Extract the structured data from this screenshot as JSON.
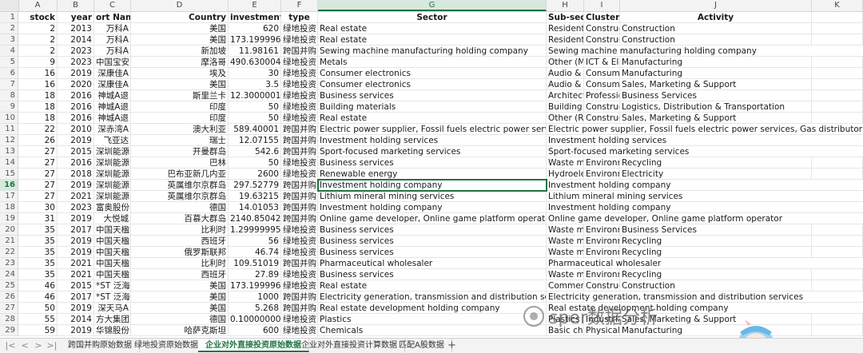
{
  "columns": [
    "A",
    "B",
    "C",
    "D",
    "E",
    "F",
    "G",
    "H",
    "I",
    "J",
    "K"
  ],
  "selected_column": "G",
  "selected_row": 16,
  "header": {
    "stock": "stock",
    "year": "year",
    "name": "ort Name",
    "country": "Country",
    "investment": "investment",
    "type": "type",
    "sector": "Sector",
    "subsector": "Sub-secto",
    "cluster": "Cluster",
    "activity": "Activity"
  },
  "rows": [
    {
      "n": 2,
      "a": "2",
      "b": "2013",
      "c": "万科A",
      "d": "美国",
      "e": "620",
      "f": "绿地投资",
      "g": "Real estate",
      "h": "Residentia",
      "i": "Construct",
      "j": "Construction"
    },
    {
      "n": 3,
      "a": "2",
      "b": "2014",
      "c": "万科A",
      "d": "美国",
      "e": "173.1999969",
      "f": "绿地投资",
      "g": "Real estate",
      "h": "Residentia",
      "i": "Construct",
      "j": "Construction"
    },
    {
      "n": 4,
      "a": "2",
      "b": "2023",
      "c": "万科A",
      "d": "新加坡",
      "e": "11.98161",
      "f": "跨国并购",
      "g": "Sewing machine manufacturing holding company",
      "h": "Sewing machine manufacturing holding company",
      "i": "",
      "j": ""
    },
    {
      "n": 5,
      "a": "9",
      "b": "2023",
      "c": "中国宝安",
      "d": "摩洛哥",
      "e": "490.6300049",
      "f": "绿地投资",
      "g": "Metals",
      "h": "Other (Me",
      "i": "ICT & Elec",
      "j": "Manufacturing"
    },
    {
      "n": 6,
      "a": "16",
      "b": "2019",
      "c": "深康佳A",
      "d": "埃及",
      "e": "30",
      "f": "绿地投资",
      "g": "Consumer electronics",
      "h": "Audio & v",
      "i": "Consumer",
      "j": "Manufacturing"
    },
    {
      "n": 7,
      "a": "16",
      "b": "2020",
      "c": "深康佳A",
      "d": "美国",
      "e": "3.5",
      "f": "绿地投资",
      "g": "Consumer electronics",
      "h": "Audio & v",
      "i": "Consumer",
      "j": "Sales, Marketing & Support"
    },
    {
      "n": 8,
      "a": "18",
      "b": "2016",
      "c": "神城A退",
      "d": "斯里兰卡",
      "e": "12.30000019",
      "f": "绿地投资",
      "g": "Business services",
      "h": "Architectu",
      "i": "Professior",
      "j": "Business Services"
    },
    {
      "n": 9,
      "a": "18",
      "b": "2016",
      "c": "神城A退",
      "d": "印度",
      "e": "50",
      "f": "绿地投资",
      "g": "Building materials",
      "h": "Building n",
      "i": "Construct",
      "j": "Logistics, Distribution & Transportation"
    },
    {
      "n": 10,
      "a": "18",
      "b": "2016",
      "c": "神城A退",
      "d": "印度",
      "e": "50",
      "f": "绿地投资",
      "g": "Real estate",
      "h": "Other (Re",
      "i": "Construct",
      "j": "Sales, Marketing & Support"
    },
    {
      "n": 11,
      "a": "22",
      "b": "2010",
      "c": "深赤湾A",
      "d": "澳大利亚",
      "e": "589.40001",
      "f": "跨国并购",
      "g": "Electric power supplier, Fossil fuels electric power services, Gas d",
      "h": "Electric power supplier, Fossil fuels electric power services, Gas distributor, Nuclear ele",
      "i": "",
      "j": ""
    },
    {
      "n": 12,
      "a": "26",
      "b": "2019",
      "c": "飞亚达",
      "d": "瑞士",
      "e": "12.07155",
      "f": "跨国并购",
      "g": "Investment holding services",
      "h": "Investment holding services",
      "i": "",
      "j": ""
    },
    {
      "n": 13,
      "a": "27",
      "b": "2015",
      "c": "深圳能源",
      "d": "开曼群岛",
      "e": "542.6",
      "f": "跨国并购",
      "g": "Sport-focused marketing services",
      "h": "Sport-focused marketing services",
      "i": "",
      "j": ""
    },
    {
      "n": 14,
      "a": "27",
      "b": "2016",
      "c": "深圳能源",
      "d": "巴林",
      "e": "50",
      "f": "绿地投资",
      "g": "Business services",
      "h": "Waste ma",
      "i": "Environme",
      "j": "Recycling"
    },
    {
      "n": 15,
      "a": "27",
      "b": "2018",
      "c": "深圳能源",
      "d": "巴布亚新几内亚",
      "e": "2600",
      "f": "绿地投资",
      "g": "Renewable energy",
      "h": "Hydroelec",
      "i": "Environme",
      "j": "Electricity"
    },
    {
      "n": 16,
      "a": "27",
      "b": "2019",
      "c": "深圳能源",
      "d": "英属维尔京群岛",
      "e": "297.52779",
      "f": "跨国并购",
      "g": "Investment holding company",
      "h": "Investment holding company",
      "i": "",
      "j": ""
    },
    {
      "n": 17,
      "a": "27",
      "b": "2021",
      "c": "深圳能源",
      "d": "英属维尔京群岛",
      "e": "19.63215",
      "f": "跨国并购",
      "g": "Lithium mineral mining services",
      "h": "Lithium mineral mining services",
      "i": "",
      "j": ""
    },
    {
      "n": 18,
      "a": "30",
      "b": "2023",
      "c": "富奥股份",
      "d": "德国",
      "e": "14.01053",
      "f": "跨国并购",
      "g": "Investment holding company",
      "h": "Investment holding company",
      "i": "",
      "j": ""
    },
    {
      "n": 19,
      "a": "31",
      "b": "2019",
      "c": "大悦城",
      "d": "百慕大群岛",
      "e": "2140.85042",
      "f": "跨国并购",
      "g": "Online game developer, Online game platform operator",
      "h": "Online game developer, Online game platform operator",
      "i": "",
      "j": ""
    },
    {
      "n": 20,
      "a": "35",
      "b": "2017",
      "c": "中国天楹",
      "d": "比利时",
      "e": "1.299999952",
      "f": "绿地投资",
      "g": "Business services",
      "h": "Waste ma",
      "i": "Environme",
      "j": "Business Services"
    },
    {
      "n": 21,
      "a": "35",
      "b": "2019",
      "c": "中国天楹",
      "d": "西班牙",
      "e": "56",
      "f": "绿地投资",
      "g": "Business services",
      "h": "Waste ma",
      "i": "Environme",
      "j": "Recycling"
    },
    {
      "n": 22,
      "a": "35",
      "b": "2019",
      "c": "中国天楹",
      "d": "俄罗斯联邦",
      "e": "46.74",
      "f": "绿地投资",
      "g": "Business services",
      "h": "Waste ma",
      "i": "Environme",
      "j": "Recycling"
    },
    {
      "n": 23,
      "a": "35",
      "b": "2021",
      "c": "中国天楹",
      "d": "比利时",
      "e": "109.51019",
      "f": "跨国并购",
      "g": "Pharmaceutical wholesaler",
      "h": "Pharmaceutical wholesaler",
      "i": "",
      "j": ""
    },
    {
      "n": 24,
      "a": "35",
      "b": "2021",
      "c": "中国天楹",
      "d": "西班牙",
      "e": "27.89",
      "f": "绿地投资",
      "g": "Business services",
      "h": "Waste ma",
      "i": "Environme",
      "j": "Recycling"
    },
    {
      "n": 25,
      "a": "46",
      "b": "2015",
      "c": "*ST 泛海",
      "d": "美国",
      "e": "173.1999969",
      "f": "绿地投资",
      "g": "Real estate",
      "h": "Commerc",
      "i": "Construct",
      "j": "Construction"
    },
    {
      "n": 26,
      "a": "46",
      "b": "2017",
      "c": "*ST 泛海",
      "d": "美国",
      "e": "1000",
      "f": "跨国并购",
      "g": "Electricity generation, transmission and distribution services",
      "h": "Electricity generation, transmission and distribution services",
      "i": "",
      "j": ""
    },
    {
      "n": 27,
      "a": "50",
      "b": "2019",
      "c": "深天马A",
      "d": "美国",
      "e": "5.268",
      "f": "跨国并购",
      "g": "Real estate development holding company",
      "h": "Real estate development holding company",
      "i": "",
      "j": ""
    },
    {
      "n": 28,
      "a": "55",
      "b": "2014",
      "c": "方大集团",
      "d": "德国",
      "e": "0.100000001",
      "f": "绿地投资",
      "g": "Plastics",
      "h": "Plastics p",
      "i": "Industrial",
      "j": "Sales, Marketing & Support"
    },
    {
      "n": 29,
      "a": "59",
      "b": "2019",
      "c": "华锦股份",
      "d": "哈萨克斯坦",
      "e": "600",
      "f": "绿地投资",
      "g": "Chemicals",
      "h": "Basic cher",
      "i": "Physical S",
      "j": "Manufacturing"
    }
  ],
  "tabs": [
    "跨国并购原始数据",
    "绿地投资原始数据",
    "企业对外直接投资原始数据",
    "企业对外直接投资计算数据",
    "匹配A股数据"
  ],
  "active_tab": 2,
  "nav": {
    "first": "|<",
    "prev": "<",
    "next": ">",
    "last": ">|",
    "add": "+"
  },
  "watermark": "sper数据分析",
  "colors": {
    "accent": "#217346"
  }
}
